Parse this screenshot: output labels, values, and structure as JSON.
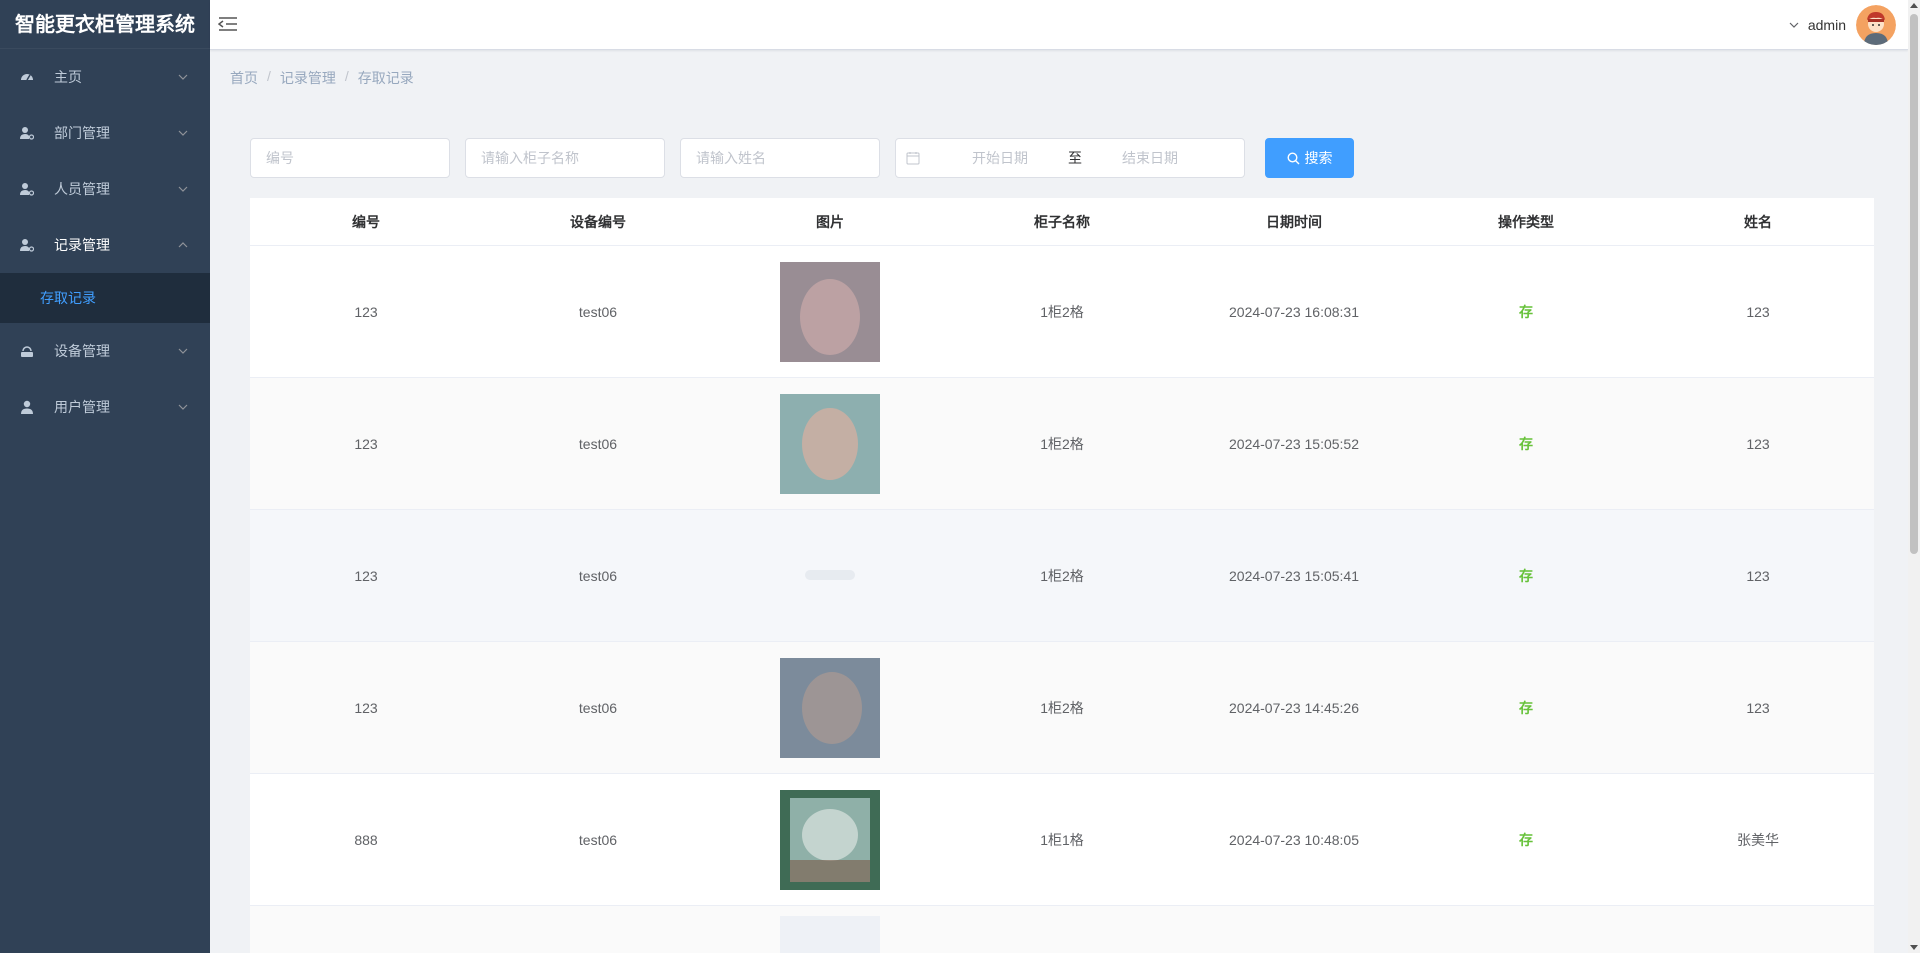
{
  "app": {
    "title": "智能更衣柜管理系统"
  },
  "sidebar": {
    "items": [
      {
        "label": "主页",
        "icon": "dashboard-icon",
        "expanded": false
      },
      {
        "label": "部门管理",
        "icon": "user-gear-icon",
        "expanded": false
      },
      {
        "label": "人员管理",
        "icon": "user-gear-icon",
        "expanded": false
      },
      {
        "label": "记录管理",
        "icon": "user-gear-icon",
        "expanded": true
      },
      {
        "label": "设备管理",
        "icon": "device-icon",
        "expanded": false
      },
      {
        "label": "用户管理",
        "icon": "user-icon",
        "expanded": false
      }
    ],
    "sub_active": "存取记录"
  },
  "header": {
    "username": "admin"
  },
  "breadcrumb": [
    "首页",
    "记录管理",
    "存取记录"
  ],
  "filters": {
    "code_placeholder": "编号",
    "cabinet_placeholder": "请输入柜子名称",
    "name_placeholder": "请输入姓名",
    "start_placeholder": "开始日期",
    "range_sep": "至",
    "end_placeholder": "结束日期",
    "search_label": "搜索"
  },
  "table": {
    "headers": [
      "编号",
      "设备编号",
      "图片",
      "柜子名称",
      "日期时间",
      "操作类型",
      "姓名"
    ],
    "rows": [
      {
        "code": "123",
        "device": "test06",
        "cabinet": "1柜2格",
        "datetime": "2024-07-23 16:08:31",
        "op": "存",
        "name": "123"
      },
      {
        "code": "123",
        "device": "test06",
        "cabinet": "1柜2格",
        "datetime": "2024-07-23 15:05:52",
        "op": "存",
        "name": "123"
      },
      {
        "code": "123",
        "device": "test06",
        "cabinet": "1柜2格",
        "datetime": "2024-07-23 15:05:41",
        "op": "存",
        "name": "123"
      },
      {
        "code": "123",
        "device": "test06",
        "cabinet": "1柜2格",
        "datetime": "2024-07-23 14:45:26",
        "op": "存",
        "name": "123"
      },
      {
        "code": "888",
        "device": "test06",
        "cabinet": "1柜1格",
        "datetime": "2024-07-23 10:48:05",
        "op": "存",
        "name": "张美华"
      }
    ]
  },
  "colors": {
    "sidebar_bg": "#304156",
    "accent": "#409eff",
    "op_green": "#67c23a"
  }
}
